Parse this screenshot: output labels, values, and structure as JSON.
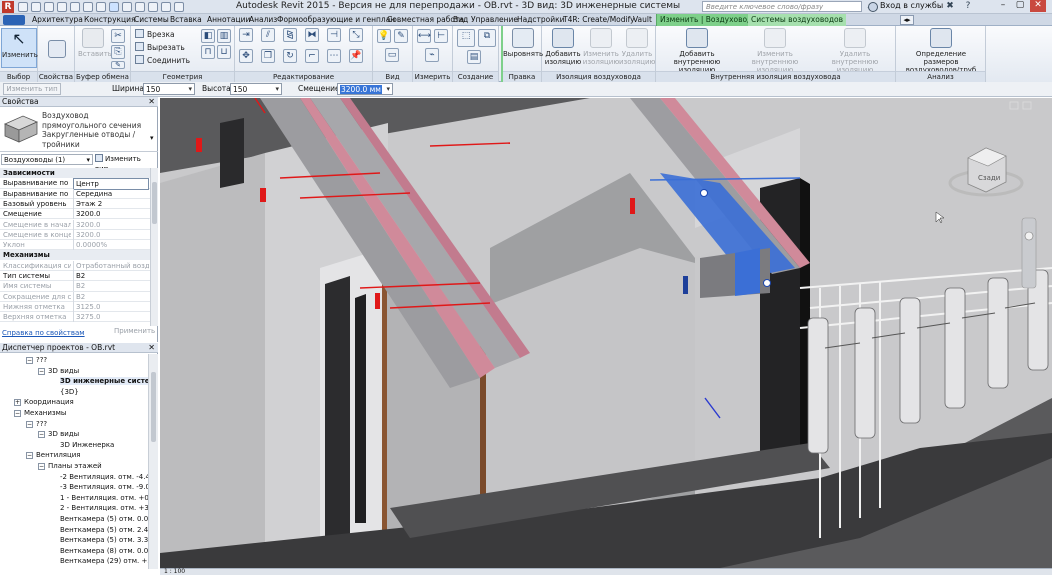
{
  "window": {
    "title": "Autodesk Revit 2015 - Версия не для перепродажи -    OB.rvt - 3D вид: 3D инженерные системы",
    "search_placeholder": "Введите ключевое слово/фразу",
    "signin": "Вход в службы"
  },
  "tabs": [
    "Архитектура",
    "Конструкция",
    "Системы",
    "Вставка",
    "Аннотации",
    "Анализ",
    "Формообразующие и генплан",
    "Совместная работа",
    "Вид",
    "Управление",
    "Надстройки",
    "T4R: Create/Modify",
    "Vault",
    "Изменить | Воздуховоды",
    "Системы воздуховодов"
  ],
  "ribbon": {
    "select": {
      "modify": "Изменить",
      "label": "Выбор"
    },
    "properties": {
      "label": "Свойства"
    },
    "clipboard": {
      "paste": "Вставить",
      "label": "Буфер обмена"
    },
    "geometry": {
      "items": [
        "Врезка",
        "Вырезать",
        "Соединить"
      ],
      "label": "Геометрия"
    },
    "modify": {
      "label": "Редактирование"
    },
    "view": {
      "label": "Вид"
    },
    "measure": {
      "label": "Измерить"
    },
    "create": {
      "label": "Создание"
    },
    "edit": {
      "align": "Выровнять",
      "label": "Правка"
    },
    "insulation": {
      "add": "Добавить изоляцию",
      "change": "Изменить изоляцию",
      "remove": "Удалить изоляцию",
      "label": "Изоляция воздуховода"
    },
    "lining": {
      "add": "Добавить внутреннюю изоляцию",
      "change": "Изменить внутреннюю изоляцию",
      "remove": "Удалить внутреннюю изоляцию",
      "label": "Внутренняя изоляция воздуховода"
    },
    "analysis": {
      "sizing": "Определение размеров воздуховодов/труб",
      "label": "Анализ"
    }
  },
  "options_bar": {
    "change_type": "Изменить тип",
    "width_label": "Ширина:",
    "width": "150",
    "height_label": "Высота:",
    "height": "150",
    "offset_label": "Смещение:",
    "offset": "3200.0 мм"
  },
  "properties": {
    "title": "Свойства",
    "type_name": "Воздуховод прямоугольного сечения Закругленные отводы / тройники",
    "filter": "Воздуховоды (1)",
    "edit_type": "Изменить тип",
    "sections": [
      {
        "name": "Зависимости",
        "rows": [
          {
            "k": "Выравнивание по г...",
            "v": "Центр",
            "dim": false
          },
          {
            "k": "Выравнивание по ...",
            "v": "Середина",
            "dim": false
          },
          {
            "k": "Базовый уровень",
            "v": "Этаж 2",
            "dim": false
          },
          {
            "k": "Смещение",
            "v": "3200.0",
            "dim": false
          },
          {
            "k": "Смещение в начале",
            "v": "3200.0",
            "dim": true
          },
          {
            "k": "Смещение в конце",
            "v": "3200.0",
            "dim": true
          },
          {
            "k": "Уклон",
            "v": "0.0000%",
            "dim": true
          }
        ]
      },
      {
        "name": "Механизмы",
        "rows": [
          {
            "k": "Классификация си...",
            "v": "Отработанный возду",
            "dim": true
          },
          {
            "k": "Тип системы",
            "v": "В2",
            "dim": false
          },
          {
            "k": "Имя системы",
            "v": "В2",
            "dim": true
          },
          {
            "k": "Сокращение для с...",
            "v": "В2",
            "dim": true
          },
          {
            "k": "Нижняя отметка",
            "v": "3125.0",
            "dim": true
          },
          {
            "k": "Верхняя отметка",
            "v": "3275.0",
            "dim": true
          }
        ]
      }
    ],
    "help_link": "Справка по свойствам",
    "apply": "Применить"
  },
  "browser": {
    "title": "Диспетчер проектов - OB.rvt",
    "nodes": [
      {
        "t": "???",
        "lvl": 2,
        "tg": "-"
      },
      {
        "t": "3D виды",
        "lvl": 3,
        "tg": "-"
      },
      {
        "t": "3D инженерные систем",
        "lvl": 4,
        "tg": "",
        "bold": true
      },
      {
        "t": "{3D}",
        "lvl": 4,
        "tg": ""
      },
      {
        "t": "Координация",
        "lvl": 1,
        "tg": "+"
      },
      {
        "t": "Механизмы",
        "lvl": 1,
        "tg": "-"
      },
      {
        "t": "???",
        "lvl": 2,
        "tg": "-"
      },
      {
        "t": "3D виды",
        "lvl": 3,
        "tg": "-"
      },
      {
        "t": "3D Инженерка",
        "lvl": 4,
        "tg": ""
      },
      {
        "t": "Вентиляция",
        "lvl": 2,
        "tg": "-"
      },
      {
        "t": "Планы этажей",
        "lvl": 3,
        "tg": "-"
      },
      {
        "t": "-2 Вентиляция. отм. -4.40",
        "lvl": 4,
        "tg": ""
      },
      {
        "t": "-3 Вентиляция. отм. -9.00",
        "lvl": 4,
        "tg": ""
      },
      {
        "t": "1 - Вентиляция. отм. +0.0",
        "lvl": 4,
        "tg": ""
      },
      {
        "t": "2 - Вентиляция. отм. +3.80",
        "lvl": 4,
        "tg": ""
      },
      {
        "t": "Венткамера (5) отм. 0.000",
        "lvl": 4,
        "tg": ""
      },
      {
        "t": "Венткамера (5) отм. 2.400",
        "lvl": 4,
        "tg": ""
      },
      {
        "t": "Венткамера (5) отм. 3.300",
        "lvl": 4,
        "tg": ""
      },
      {
        "t": "Венткамера (8) отм. 0.000",
        "lvl": 4,
        "tg": ""
      },
      {
        "t": "Венткамера (29) отм. +3.8",
        "lvl": 4,
        "tg": ""
      }
    ]
  },
  "viewcube": {
    "face": "Сзади"
  },
  "status": {
    "scale": "1 : 100"
  },
  "colors": {
    "selected_duct": "#3b6fd6",
    "pink_duct": "#d08a9a",
    "red_marker": "#e01818",
    "context_tab": "#7ed08a"
  }
}
